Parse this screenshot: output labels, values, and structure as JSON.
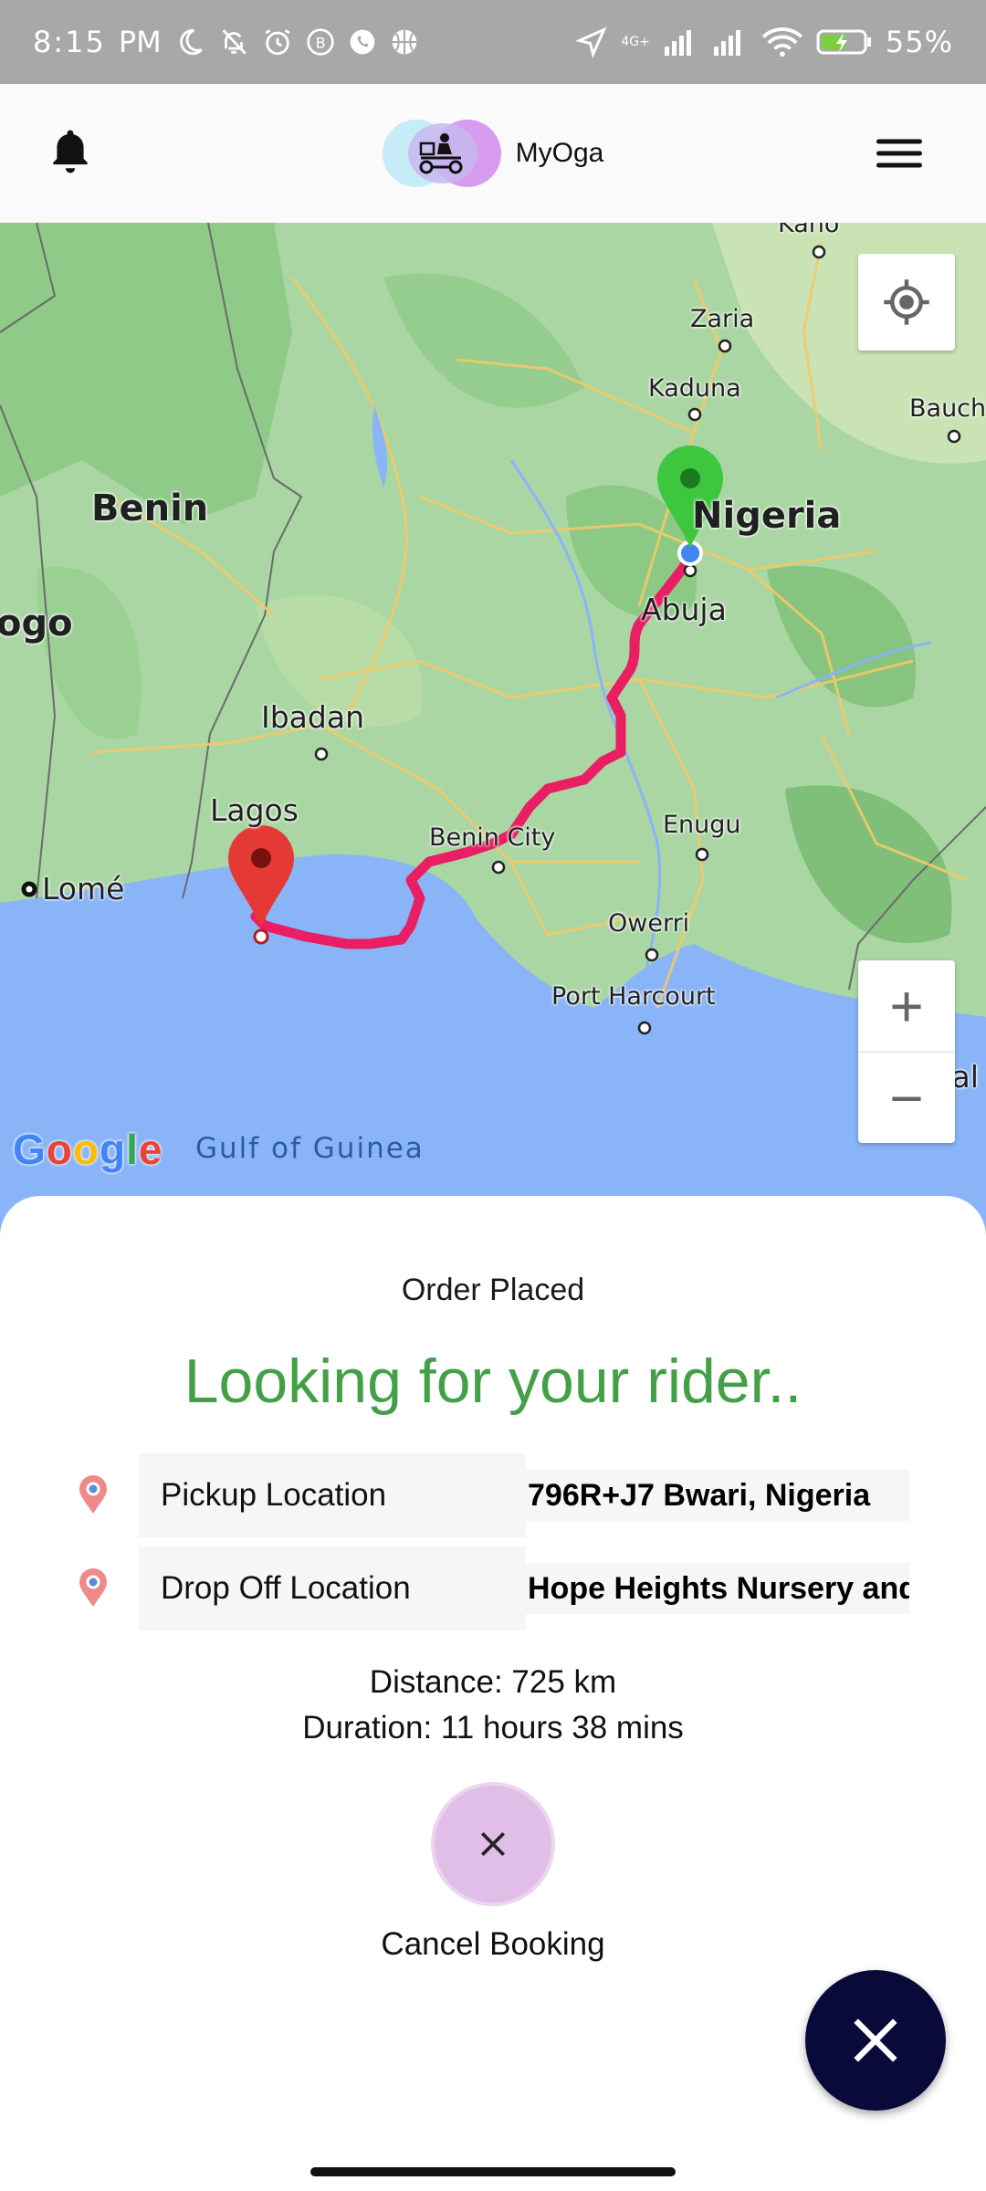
{
  "status_bar": {
    "time": "8:15",
    "ampm": "PM",
    "network": "4G+",
    "battery": "55%"
  },
  "header": {
    "app_name": "MyOga",
    "icons": [
      "bell-icon",
      "delivery-rider-logo",
      "hamburger-menu-icon"
    ]
  },
  "map": {
    "labels": {
      "benin": "Benin",
      "nigeria": "Nigeria",
      "togo": "ogo",
      "zaria": "Zaria",
      "kaduna": "Kaduna",
      "bauchi": "Bauch",
      "kano": "Kano",
      "abuja": "Abuja",
      "ibadan": "Ibadan",
      "lagos": "Lagos",
      "benin_city": "Benin City",
      "enugu": "Enugu",
      "owerri": "Owerri",
      "port_harcourt": "Port Harcourt",
      "lome": "Lomé",
      "douala": "Doual",
      "gulf": "Gulf of Guinea"
    },
    "attribution": "Google",
    "zoom_in": "+",
    "zoom_out": "−",
    "colors": {
      "land": "#a9d6a3",
      "water": "#8ab4f8",
      "route": "#e91e63",
      "pickup_pin": "#3ec73e",
      "dropoff_pin": "#e53935"
    }
  },
  "order": {
    "status": "Order Placed",
    "headline": "Looking for your rider..",
    "pickup_label": "Pickup Location",
    "pickup_value": "796R+J7 Bwari, Nigeria",
    "dropoff_label": "Drop Off Location",
    "dropoff_value": "Hope Heights Nursery and Primary School",
    "distance": "Distance: 725 km",
    "duration": "Duration: 11 hours 38 mins",
    "cancel_label": "Cancel Booking",
    "accent": "#43a047"
  }
}
